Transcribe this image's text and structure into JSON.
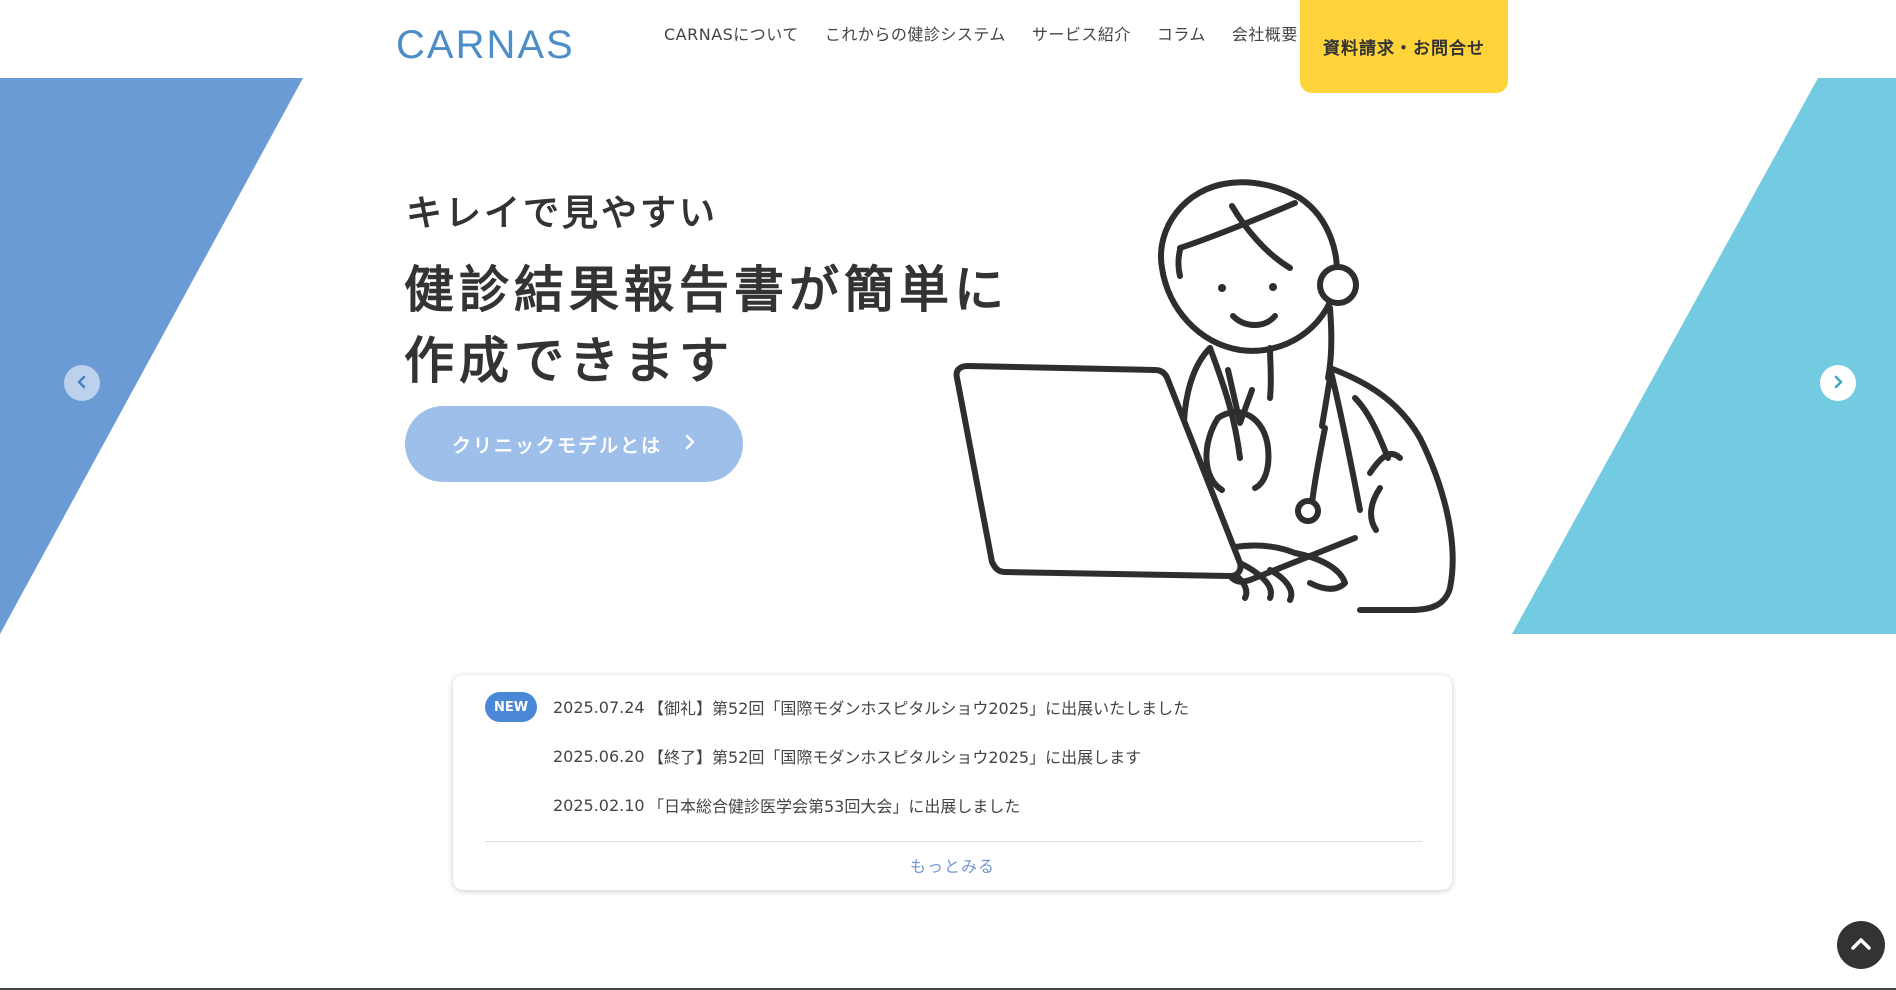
{
  "header": {
    "logo_text": "CARNAS",
    "nav": [
      {
        "label": "CARNASについて"
      },
      {
        "label": "これからの健診システム"
      },
      {
        "label": "サービス紹介"
      },
      {
        "label": "コラム"
      },
      {
        "label": "会社概要"
      }
    ],
    "cta_label": "資料請求・お問合せ"
  },
  "hero": {
    "subtitle": "キレイで見やすい",
    "title_line1": "健診結果報告書が簡単に",
    "title_line2": "作成できます",
    "button_label": "クリニックモデルとは",
    "prev_icon": "chevron-left-icon",
    "next_icon": "chevron-right-icon"
  },
  "news": {
    "badge": "NEW",
    "items": [
      {
        "date": "2025.07.24",
        "title": "【御礼】第52回「国際モダンホスピタルショウ2025」に出展いたしました"
      },
      {
        "date": "2025.06.20",
        "title": "【終了】第52回「国際モダンホスピタルショウ2025」に出展します"
      },
      {
        "date": "2025.02.10",
        "title": "「日本総合健診医学会第53回大会」に出展しました"
      }
    ],
    "more_label": "もっとみる"
  },
  "colors": {
    "left_shape": "#6a9bd4",
    "right_shape": "#72cbe0",
    "cta": "#ffd43b",
    "clinic_button": "#9dbfea",
    "badge": "#4a87d6",
    "more_link": "#6e97cf",
    "logo_blue": "#4d8ec9"
  }
}
